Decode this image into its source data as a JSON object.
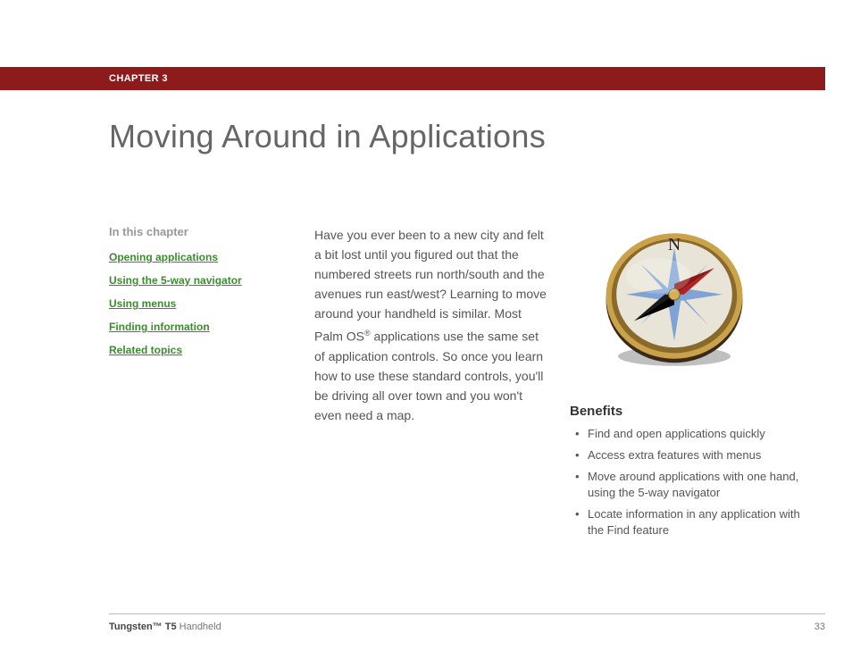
{
  "chapter": {
    "label": "CHAPTER 3"
  },
  "title": "Moving Around in Applications",
  "in_this_chapter": {
    "heading": "In this chapter",
    "links": [
      "Opening applications",
      "Using the 5-way navigator",
      "Using menus",
      "Finding information",
      "Related topics"
    ]
  },
  "intro": {
    "part1": "Have you ever been to a new city and felt a bit lost until you figured out that the numbered streets run north/south and the avenues run east/west? Learning to move around your handheld is similar. Most Palm OS",
    "reg": "®",
    "part2": " applications use the same set of application controls. So once you learn how to use these standard controls, you'll be driving all over town and you won't even need a map."
  },
  "benefits": {
    "heading": "Benefits",
    "items": [
      "Find and open applications quickly",
      "Access extra features with menus",
      "Move around applications with one hand, using the 5-way navigator",
      "Locate information in any application with the Find feature"
    ]
  },
  "footer": {
    "product_bold": "Tungsten™ T5",
    "product_rest": " Handheld",
    "page": "33"
  },
  "colors": {
    "bar": "#8e1b1b",
    "link": "#3b8c2f"
  }
}
